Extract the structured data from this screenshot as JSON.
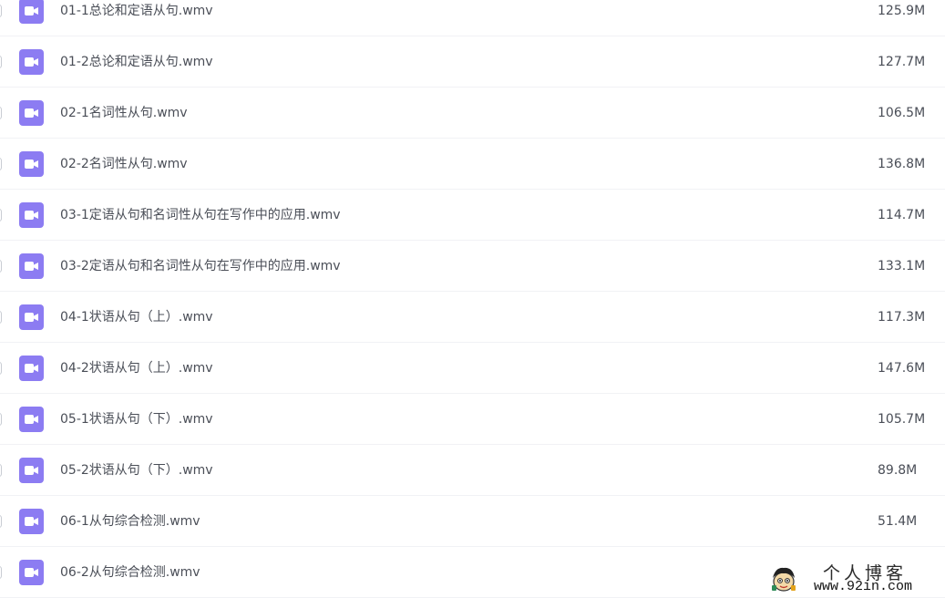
{
  "colors": {
    "icon_bg": "#8c7cf2",
    "text": "#4a4e57",
    "row_divider": "#f1f2f5"
  },
  "files": [
    {
      "name": "01-1总论和定语从句.wmv",
      "size": "125.9M",
      "icon": "video-file-icon"
    },
    {
      "name": "01-2总论和定语从句.wmv",
      "size": "127.7M",
      "icon": "video-file-icon"
    },
    {
      "name": "02-1名词性从句.wmv",
      "size": "106.5M",
      "icon": "video-file-icon"
    },
    {
      "name": "02-2名词性从句.wmv",
      "size": "136.8M",
      "icon": "video-file-icon"
    },
    {
      "name": "03-1定语从句和名词性从句在写作中的应用.wmv",
      "size": "114.7M",
      "icon": "video-file-icon"
    },
    {
      "name": "03-2定语从句和名词性从句在写作中的应用.wmv",
      "size": "133.1M",
      "icon": "video-file-icon"
    },
    {
      "name": "04-1状语从句（上）.wmv",
      "size": "117.3M",
      "icon": "video-file-icon"
    },
    {
      "name": "04-2状语从句（上）.wmv",
      "size": "147.6M",
      "icon": "video-file-icon"
    },
    {
      "name": "05-1状语从句（下）.wmv",
      "size": "105.7M",
      "icon": "video-file-icon"
    },
    {
      "name": "05-2状语从句（下）.wmv",
      "size": "89.8M",
      "icon": "video-file-icon"
    },
    {
      "name": "06-1从句综合检测.wmv",
      "size": "51.4M",
      "icon": "video-file-icon"
    },
    {
      "name": "06-2从句综合检测.wmv",
      "size": "",
      "icon": "video-file-icon"
    }
  ],
  "watermark": {
    "title": "个人博客",
    "url": "www.92in.com"
  }
}
